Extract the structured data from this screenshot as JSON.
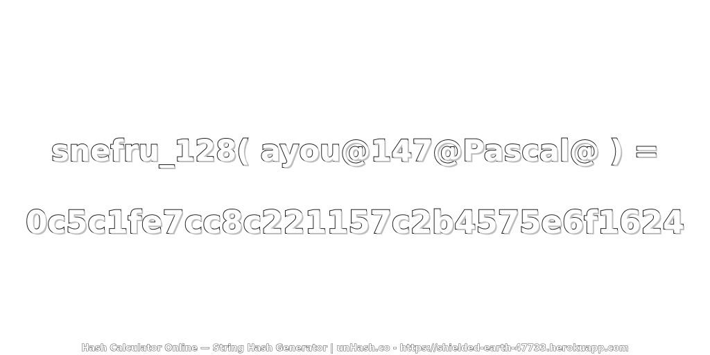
{
  "expression": "snefru_128( ayou@147@Pascal@ ) =",
  "hash_value": "0c5c1fe7cc8c221157c2b4575e6f1624",
  "footer": "Hash Calculator Online — String Hash Generator | unHash.co - https://shielded-earth-47733.herokuapp.com",
  "colors": {
    "background": "#ffffff",
    "text_fill": "#ffffff",
    "text_outline": "#1a1a1a",
    "text_shadow": "#bdbdbd"
  }
}
